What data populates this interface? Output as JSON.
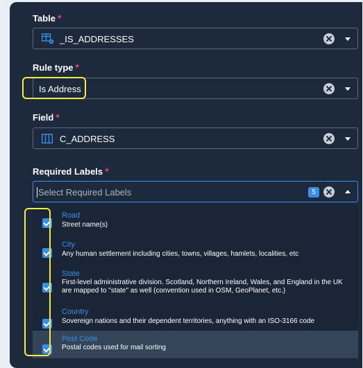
{
  "form": {
    "table": {
      "label": "Table",
      "required_mark": "*",
      "value": "_IS_ADDRESSES"
    },
    "rule_type": {
      "label": "Rule type",
      "required_mark": "*",
      "value": "Is Address"
    },
    "field": {
      "label": "Field",
      "required_mark": "*",
      "value": "C_ADDRESS"
    },
    "required_labels": {
      "label": "Required Labels",
      "required_mark": "*",
      "placeholder": "Select Required Labels",
      "count": "5"
    }
  },
  "options": [
    {
      "title": "Road",
      "desc": "Street name(s)",
      "checked": true
    },
    {
      "title": "City",
      "desc": "Any human settlement including cities, towns, villages, hamlets, localities, etc",
      "checked": true
    },
    {
      "title": "State",
      "desc": "First-level administrative division. Scotland, Northern Ireland, Wales, and England in the UK are mapped to \"state\" as well (convention used in OSM, GeoPlanet, etc.)",
      "checked": true
    },
    {
      "title": "Country",
      "desc": "Sovereign nations and their dependent territories, anything with an ISO-3166 code",
      "checked": true
    },
    {
      "title": "Post Code",
      "desc": "Postal codes used for mail sorting",
      "checked": true
    }
  ],
  "colors": {
    "panel": "#1d2a3e",
    "accent": "#3a8ee6",
    "required": "#e0407a",
    "highlight": "#f5ee3e"
  }
}
